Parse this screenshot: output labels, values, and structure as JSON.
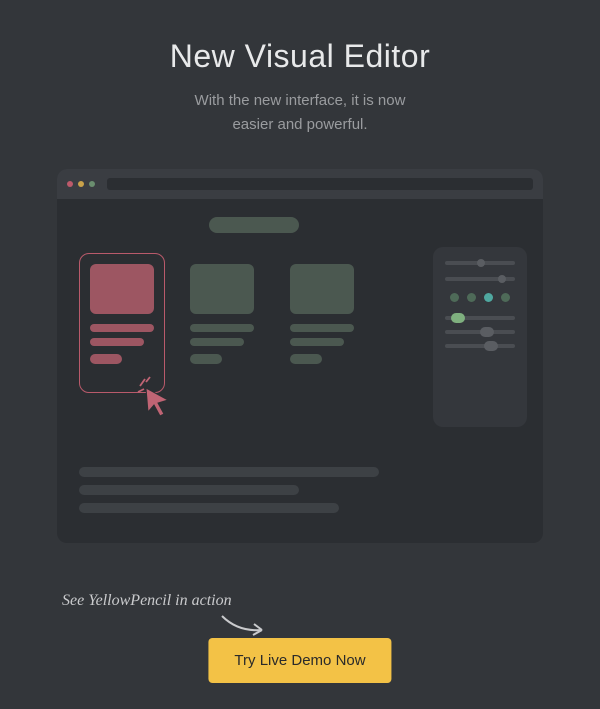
{
  "header": {
    "title": "New Visual Editor",
    "subtitle_line1": "With the new interface, it is now",
    "subtitle_line2": "easier and powerful."
  },
  "annotation": "See YellowPencil in action",
  "cta": {
    "label": "Try Live Demo Now"
  },
  "colors": {
    "accent_pink": "#b95a6b",
    "accent_green": "#7fb07f",
    "accent_teal": "#4fa8a0",
    "cta_bg": "#f3c246"
  },
  "panel": {
    "sliders_top": [
      {
        "knob_pos": 0.45,
        "knob_color": "#5a5d62"
      },
      {
        "knob_pos": 0.75,
        "knob_color": "#5a5d62"
      }
    ],
    "swatches": [
      "#4e6a58",
      "#4e6a58",
      "#4fa8a0",
      "#4e6a58"
    ],
    "sliders_bottom": [
      {
        "knob_pos": 0.15,
        "knob_color": "#7fb07f"
      },
      {
        "knob_pos": 0.55,
        "knob_color": "#5a5d62"
      },
      {
        "knob_pos": 0.6,
        "knob_color": "#5a5d62"
      }
    ]
  }
}
